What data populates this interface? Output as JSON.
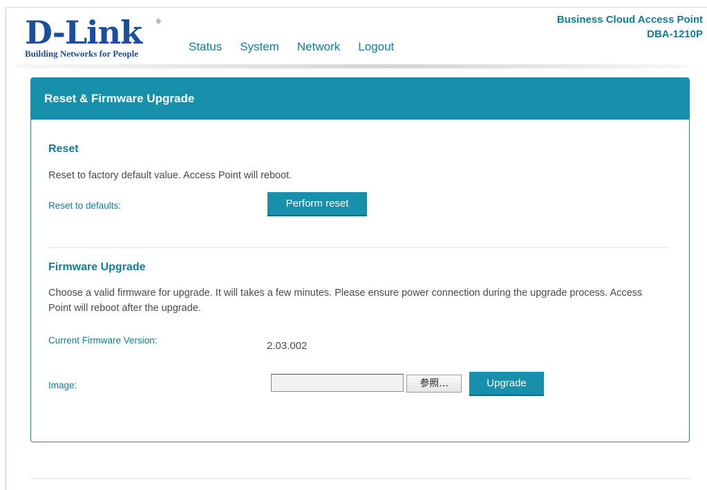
{
  "brand": {
    "logo_text": "D-Link",
    "tagline": "Building Networks for People",
    "registered": "®"
  },
  "nav": {
    "items": [
      {
        "label": "Status"
      },
      {
        "label": "System"
      },
      {
        "label": "Network"
      },
      {
        "label": "Logout"
      }
    ]
  },
  "product": {
    "line1": "Business Cloud Access Point",
    "line2": "DBA-1210P"
  },
  "panel": {
    "title": "Reset & Firmware Upgrade"
  },
  "reset": {
    "title": "Reset",
    "description": "Reset to factory default value. Access Point will reboot.",
    "label": "Reset to defaults:",
    "button": "Perform reset"
  },
  "firmware": {
    "title": "Firmware Upgrade",
    "description": "Choose a valid firmware for upgrade. It will takes a few minutes. Please ensure power connection during the upgrade process. Access Point will reboot after the upgrade.",
    "current_label": "Current Firmware Version:",
    "current_value": "2.03.002",
    "image_label": "Image:",
    "file_value": "",
    "browse_label": "参照...",
    "upgrade_button": "Upgrade"
  },
  "colors": {
    "accent": "#1790ab",
    "accent_text": "#0f7d98",
    "brand_blue": "#1a4fa0"
  }
}
